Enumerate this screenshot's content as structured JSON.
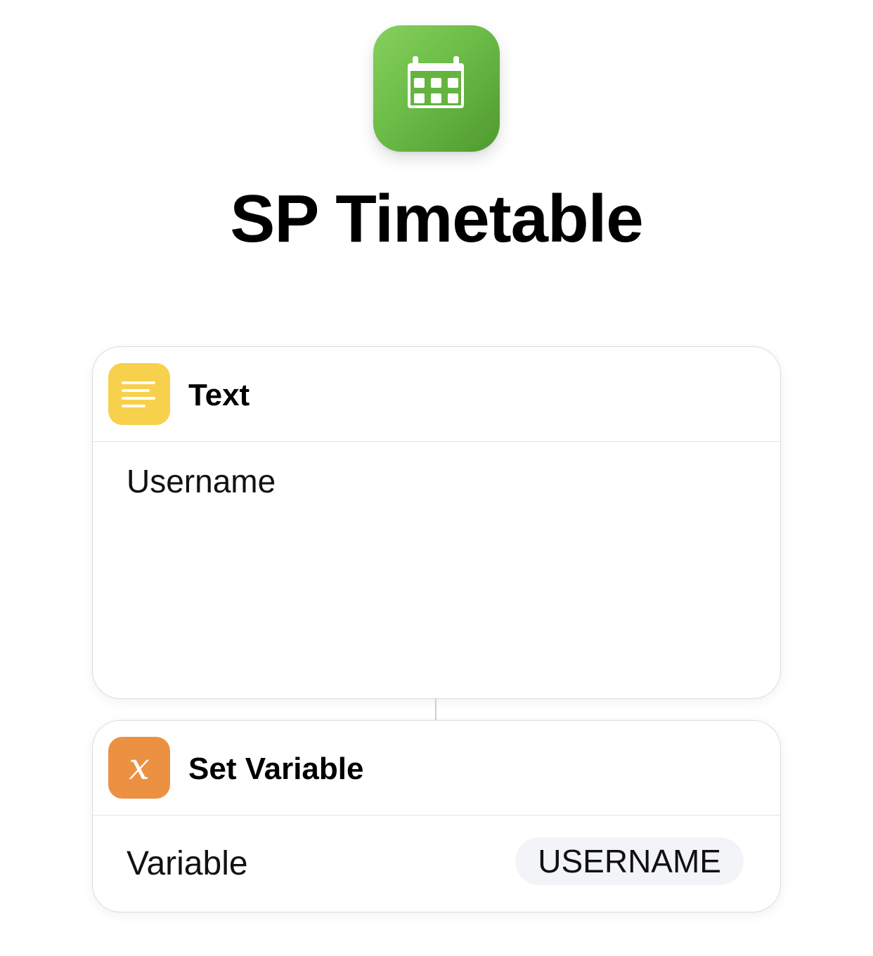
{
  "shortcut": {
    "title": "SP Timetable",
    "icon": "calendar-icon",
    "icon_color": "#6cbc48"
  },
  "actions": [
    {
      "icon": "text-lines-icon",
      "icon_color": "#f7d04c",
      "title": "Text",
      "content": "Username"
    },
    {
      "icon": "variable-x-icon",
      "icon_color": "#ec9142",
      "icon_glyph": "x",
      "title": "Set Variable",
      "param_label": "Variable",
      "param_value": "USERNAME"
    }
  ]
}
